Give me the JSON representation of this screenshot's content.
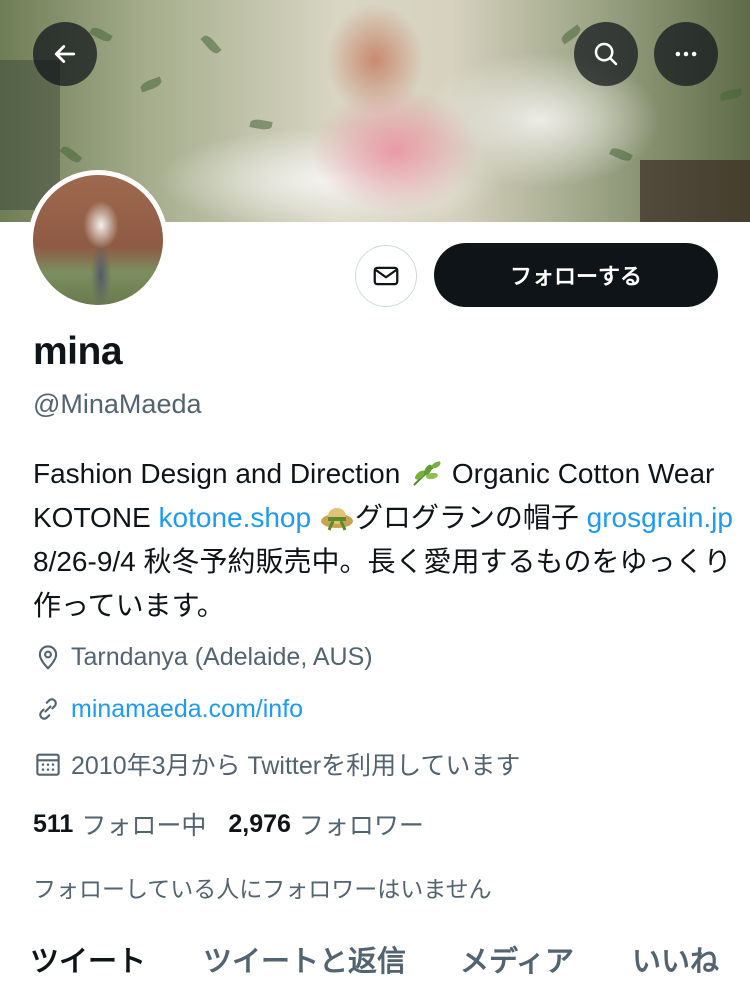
{
  "header": {
    "back_icon": "arrow-left-icon",
    "search_icon": "search-icon",
    "more_icon": "more-horizontal-icon"
  },
  "actions": {
    "message_icon": "mail-icon",
    "follow_label": "フォローする"
  },
  "profile": {
    "name": "mina",
    "handle": "@MinaMaeda",
    "bio": {
      "t1": "Fashion Design and Direction ",
      "t2": " Organic Cotton Wear KOTONE ",
      "link1": "kotone.shop",
      "t3": " ",
      "t4": "グログランの帽子 ",
      "link2": "grosgrain.jp",
      "t5": " 8/26-9/4 秋冬予約販売中。長く愛用するものをゆっくり作っています。"
    },
    "location": "Tarndanya (Adelaide, AUS)",
    "website": "minamaeda.com/info",
    "joined": "2010年3月から Twitterを利用しています",
    "following_count": "511",
    "following_label": "フォロー中",
    "followers_count": "2,976",
    "followers_label": "フォロワー",
    "followers_you_know": "フォローしている人にフォロワーはいません"
  },
  "tabs": [
    {
      "label": "ツイート"
    },
    {
      "label": "ツイートと返信"
    },
    {
      "label": "メディア"
    },
    {
      "label": "いいね"
    }
  ],
  "colors": {
    "accent": "#1d9bf0",
    "text_primary": "#0f1419",
    "text_secondary": "#536471",
    "follow_button": "#0f1419"
  }
}
